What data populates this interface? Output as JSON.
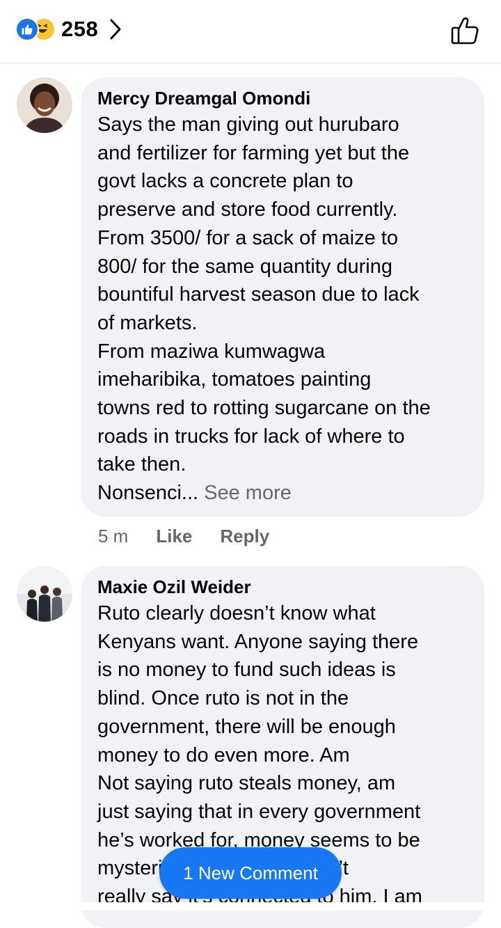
{
  "header": {
    "reaction_count": "258",
    "icons": [
      "like-reaction-icon",
      "haha-reaction-icon",
      "chevron-right-icon",
      "thumbs-up-outline-icon"
    ]
  },
  "comments": [
    {
      "author": "Mercy Dreamgal Omondi",
      "body": "Says the man giving out hurubaro\nand fertilizer for farming yet but the\ngovt lacks a concrete plan to\npreserve and store food currently.\nFrom 3500/ for a sack of maize to\n800/ for the same quantity during\nbountiful harvest season due to lack\nof markets.\nFrom maziwa kumwagwa\nimeharibika, tomatoes painting\ntowns red to rotting sugarcane on the\nroads in trucks for lack of where to\ntake then.\nNonsenci...",
      "see_more": " See more",
      "time": "5 m",
      "like_label": "Like",
      "reply_label": "Reply"
    },
    {
      "author": "Maxie Ozil Weider",
      "body": "Ruto clearly doesn’t know what\nKenyans want. Anyone saying there\nis no money to fund such ideas is\nblind. Once ruto is not in the\ngovernment, there will be enough\nmoney to do even more. Am\nNot saying ruto steals money, am\njust saying that in every government\nhe’s worked for, money seems to be\nmysteriously missing. I can’t\nreally say it’s connected to him. I am"
    }
  ],
  "new_comment_label": "1 New Comment",
  "colors": {
    "accent": "#1877f2",
    "bubble": "#f0f2f5",
    "secondary_text": "#65676b"
  }
}
